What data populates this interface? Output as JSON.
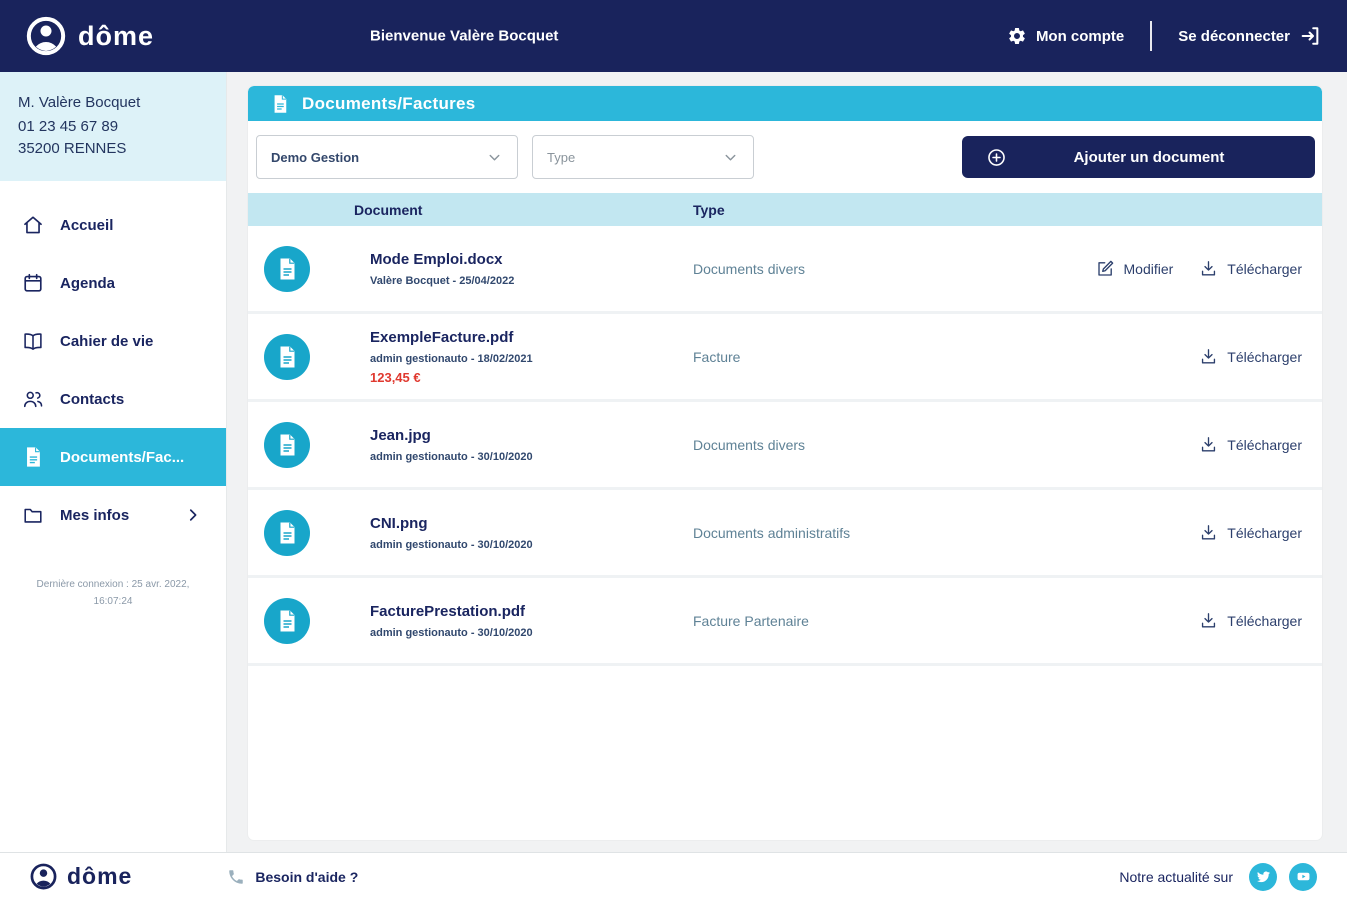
{
  "colors": {
    "navy": "#19235c",
    "cyan": "#2cb7da",
    "cyan_dark": "#18a6ca",
    "table_header": "#c2e7f1",
    "userbox_bg": "#ddf2f8",
    "price_red": "#e0392f"
  },
  "header": {
    "brand": "dôme",
    "welcome": "Bienvenue Valère Bocquet",
    "account_label": "Mon compte",
    "logout_label": "Se déconnecter"
  },
  "sidebar": {
    "user_name": "M. Valère Bocquet",
    "user_phone": "01 23 45 67 89",
    "user_city": "35200 RENNES",
    "items": [
      {
        "label": "Accueil",
        "icon": "home-icon",
        "active": false
      },
      {
        "label": "Agenda",
        "icon": "calendar-icon",
        "active": false
      },
      {
        "label": "Cahier de vie",
        "icon": "book-icon",
        "active": false
      },
      {
        "label": "Contacts",
        "icon": "people-icon",
        "active": false
      },
      {
        "label": "Documents/Fac...",
        "icon": "document-icon",
        "active": true
      },
      {
        "label": "Mes infos",
        "icon": "folder-icon",
        "active": false,
        "chevron": true
      }
    ],
    "last_connection": "Dernière connexion : 25 avr. 2022, 16:07:24"
  },
  "main": {
    "title": "Documents/Factures",
    "filter_gestion": "Demo Gestion",
    "filter_type": "Type",
    "add_button": "Ajouter un document",
    "table": {
      "col_document": "Document",
      "col_type": "Type",
      "rows": [
        {
          "name": "Mode Emploi.docx",
          "meta": "Valère Bocquet - 25/04/2022",
          "price": "",
          "type": "Documents divers",
          "actions": [
            {
              "label": "Modifier",
              "icon": "edit-icon"
            },
            {
              "label": "Télécharger",
              "icon": "download-icon"
            }
          ]
        },
        {
          "name": "ExempleFacture.pdf",
          "meta": "admin gestionauto - 18/02/2021",
          "price": "123,45 €",
          "type": "Facture",
          "actions": [
            {
              "label": "Télécharger",
              "icon": "download-icon"
            }
          ]
        },
        {
          "name": "Jean.jpg",
          "meta": "admin gestionauto - 30/10/2020",
          "price": "",
          "type": "Documents divers",
          "actions": [
            {
              "label": "Télécharger",
              "icon": "download-icon"
            }
          ]
        },
        {
          "name": "CNI.png",
          "meta": "admin gestionauto - 30/10/2020",
          "price": "",
          "type": "Documents administratifs",
          "actions": [
            {
              "label": "Télécharger",
              "icon": "download-icon"
            }
          ]
        },
        {
          "name": "FacturePrestation.pdf",
          "meta": "admin gestionauto - 30/10/2020",
          "price": "",
          "type": "Facture Partenaire",
          "actions": [
            {
              "label": "Télécharger",
              "icon": "download-icon"
            }
          ]
        }
      ]
    }
  },
  "footer": {
    "brand": "dôme",
    "help": "Besoin d'aide ?",
    "news": "Notre actualité sur"
  }
}
